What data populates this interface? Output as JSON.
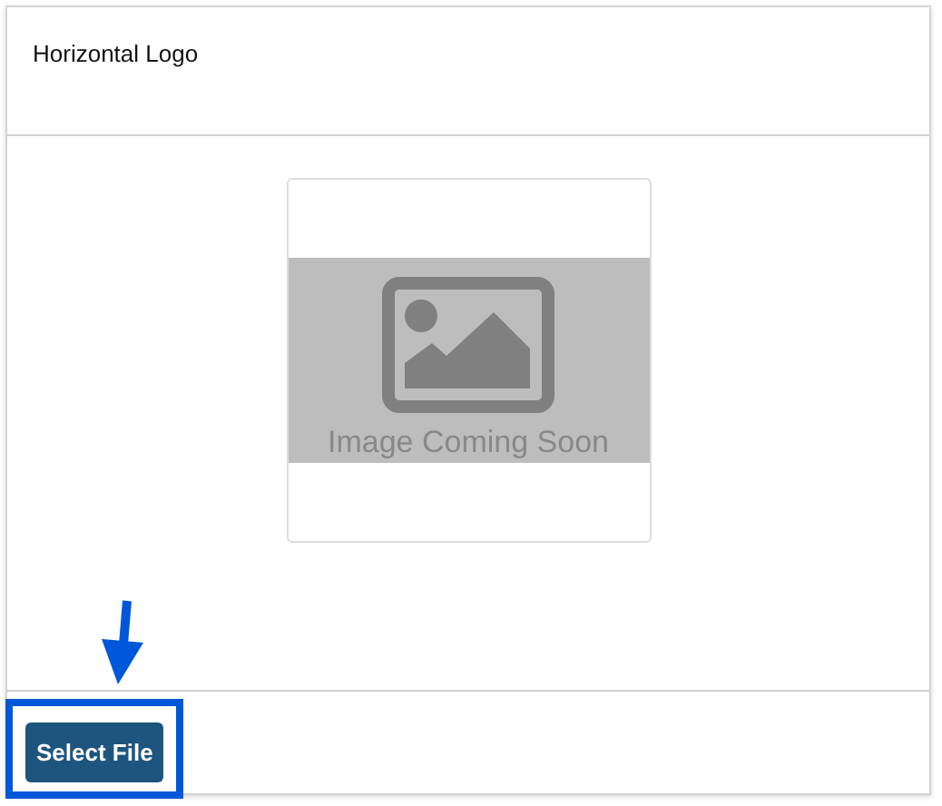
{
  "header": {
    "title": "Horizontal Logo"
  },
  "preview": {
    "placeholder_text": "Image Coming Soon"
  },
  "footer": {
    "button": "Select File",
    "highlighted": true
  }
}
